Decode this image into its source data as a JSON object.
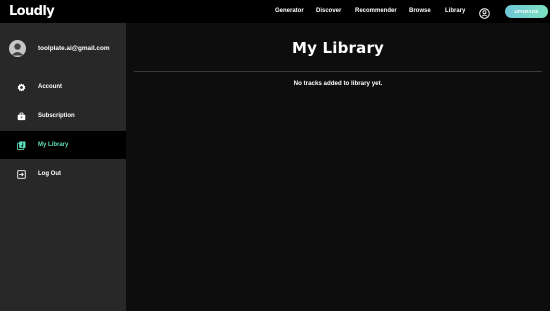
{
  "app": {
    "logo": "Loudly"
  },
  "nav": {
    "items": [
      "Generator",
      "Discover",
      "Recommender",
      "Browse",
      "Library"
    ],
    "upgrade_label": "UPGRADE"
  },
  "sidebar": {
    "email": "toolplate.ai@gmail.com",
    "items": [
      {
        "label": "Account",
        "icon": "gear-icon"
      },
      {
        "label": "Subscription",
        "icon": "briefcase-icon"
      },
      {
        "label": "My Library",
        "icon": "library-icon",
        "active": true
      },
      {
        "label": "Log Out",
        "icon": "logout-icon"
      }
    ]
  },
  "main": {
    "title": "My Library",
    "empty_message": "No tracks added to library yet."
  },
  "colors": {
    "accent": "#5fe0bf",
    "upgrade_gradient_start": "#6ec6d8",
    "upgrade_gradient_end": "#7be3c1",
    "sidebar_bg": "#282828",
    "main_bg": "#0d0d0d",
    "topbar_bg": "#000000"
  }
}
